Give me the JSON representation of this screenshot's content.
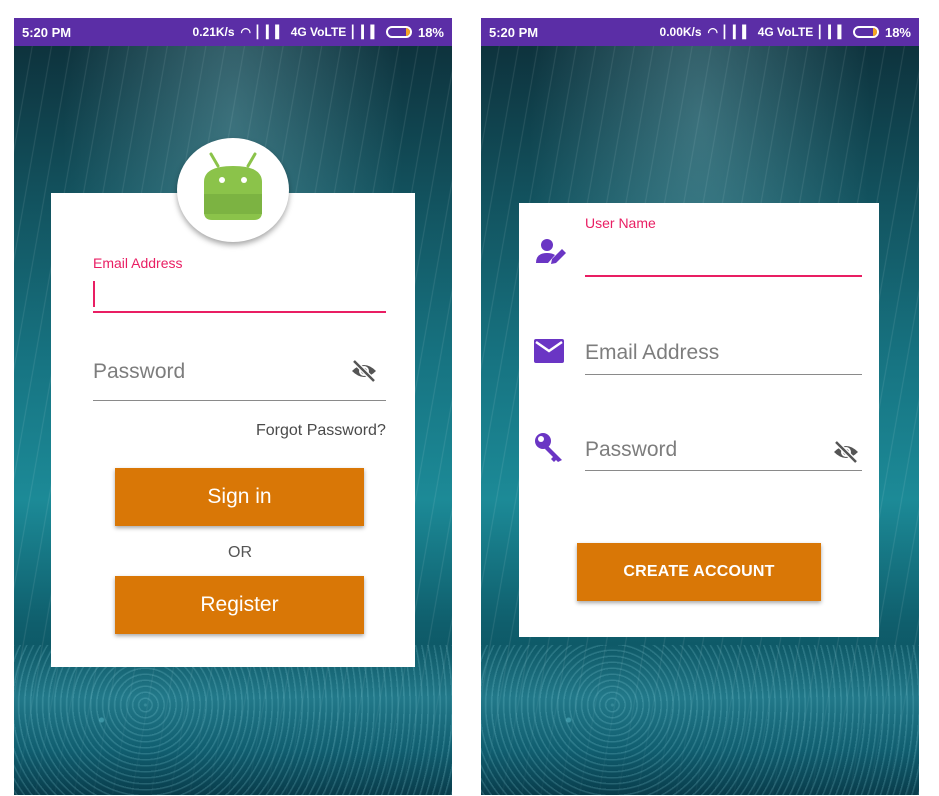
{
  "colors": {
    "status_bar": "#5b2ea6",
    "accent_pink": "#e91e63",
    "button_orange": "#d97706",
    "icon_purple": "#6a35c4",
    "android_green": "#8bc34a"
  },
  "left_screen": {
    "status_bar": {
      "time": "5:20 PM",
      "speed": "0.21K/s",
      "network": "4G VoLTE",
      "battery": "18%",
      "battery_level": 0.18
    },
    "logo_icon": "android-icon",
    "email": {
      "label": "Email Address",
      "value": ""
    },
    "password": {
      "placeholder": "Password",
      "toggle_icon": "eye-off-icon"
    },
    "forgot_password": "Forgot Password?",
    "sign_in": "Sign in",
    "or": "OR",
    "register": "Register"
  },
  "right_screen": {
    "status_bar": {
      "time": "5:20 PM",
      "speed": "0.00K/s",
      "network": "4G VoLTE",
      "battery": "18%",
      "battery_level": 0.18
    },
    "user_name": {
      "label": "User Name",
      "value": "",
      "icon": "user-edit-icon"
    },
    "email": {
      "placeholder": "Email Address",
      "icon": "mail-icon"
    },
    "password": {
      "placeholder": "Password",
      "icon": "key-icon",
      "toggle_icon": "eye-off-icon"
    },
    "create_account": "CREATE ACCOUNT"
  }
}
